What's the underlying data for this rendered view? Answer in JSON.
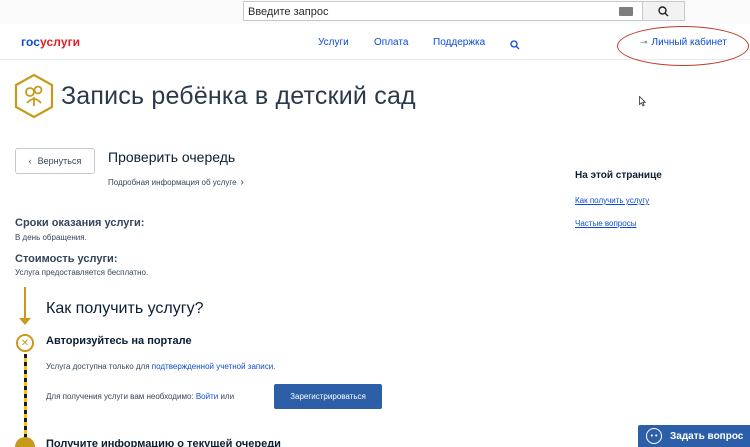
{
  "search": {
    "placeholder": "Введите запрос"
  },
  "header": {
    "logo_part1": "гос",
    "logo_part2": "услуги",
    "nav": [
      {
        "label": "Услуги"
      },
      {
        "label": "Оплата"
      },
      {
        "label": "Поддержка"
      }
    ],
    "cabinet_label": "Личный кабинет"
  },
  "page": {
    "title": "Запись ребёнка в детский сад"
  },
  "service": {
    "back_label": "Вернуться",
    "check_title": "Проверить очередь",
    "more_info": "Подробная информация об услуге",
    "terms_title": "Сроки оказания услуги:",
    "terms_value": "В день обращения.",
    "cost_title": "Стоимость услуги:",
    "cost_value": "Услуга предоставляется бесплатно."
  },
  "sidebar": {
    "title": "На этой странице",
    "links": [
      {
        "label": "Как получить услугу"
      },
      {
        "label": "Частые вопросы"
      }
    ]
  },
  "how": {
    "title": "Как получить услугу?",
    "step1_title": "Авторизуйтесь на портале",
    "step1_text_before": "Услуга доступна только для ",
    "step1_text_link": "подтвержденной учетной записи",
    "step1_text_after": ".",
    "step1_need_text": "Для получения услуги вам необходимо: ",
    "login_link": "Войти",
    "or_text": " или",
    "register_button": "Зарегистрироваться",
    "step2_partial": "Получите информацию о текущей очереди"
  },
  "widget": {
    "ask_label": "Задать вопрос"
  },
  "colors": {
    "brand_blue": "#0d4cd3",
    "brand_red": "#e31e24",
    "accent_gold": "#c79a1a",
    "button_blue": "#2d5fa8"
  }
}
